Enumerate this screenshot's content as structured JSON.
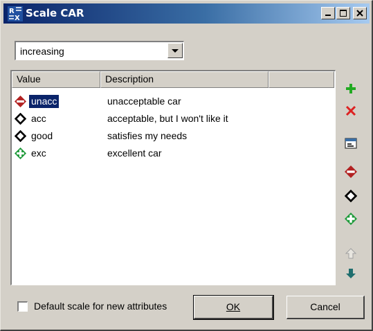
{
  "window": {
    "title": "Scale CAR"
  },
  "order_select": {
    "value": "increasing"
  },
  "table": {
    "columns": [
      "Value",
      "Description"
    ],
    "rows": [
      {
        "value": "unacc",
        "description": "unacceptable car",
        "icon": "red-minus-diamond-icon",
        "selected": true
      },
      {
        "value": "acc",
        "description": "acceptable, but I won't like it",
        "icon": "black-diamond-icon",
        "selected": false
      },
      {
        "value": "good",
        "description": "satisfies my needs",
        "icon": "black-diamond-icon",
        "selected": false
      },
      {
        "value": "exc",
        "description": "excellent car",
        "icon": "green-plus-diamond-icon",
        "selected": false
      }
    ]
  },
  "side_toolbar": [
    "add-icon",
    "delete-icon",
    "edit-icon",
    "set-bad-icon",
    "set-neutral-icon",
    "set-good-icon",
    "move-up-icon",
    "move-down-icon"
  ],
  "footer": {
    "default_scale_label": "Default scale for new attributes",
    "default_scale_checked": false,
    "ok_label": "OK",
    "cancel_label": "Cancel"
  },
  "colors": {
    "title_start": "#0a246a",
    "title_end": "#a6caf0",
    "face": "#d4d0c8",
    "bad": "#b22222",
    "good": "#1e9a3a",
    "selection": "#0a246a"
  }
}
